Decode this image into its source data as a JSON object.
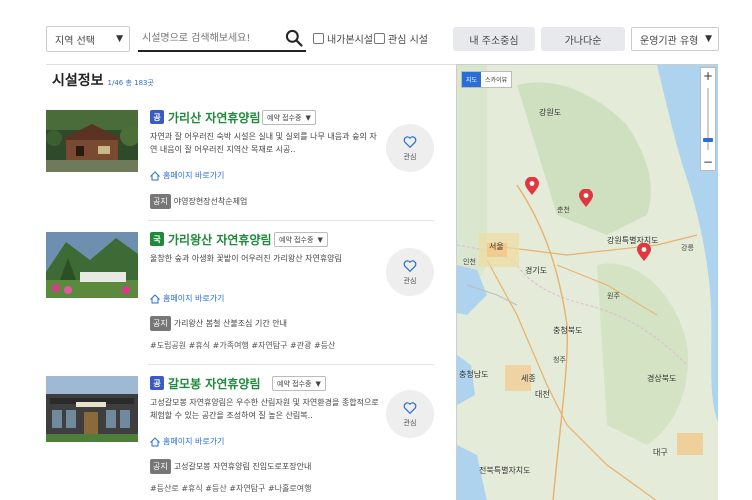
{
  "filters": {
    "region_select": "지역 선택",
    "search_placeholder": "시설명으로 검색해보세요!",
    "visited_label": "내가본시설",
    "interest_label": "관심 시설",
    "address_button": "내 주소중심",
    "alpha_button": "가나다순",
    "org_type_select": "운영기관 유형"
  },
  "list": {
    "title": "시설정보",
    "count": "1/46 총 183곳"
  },
  "facilities": [
    {
      "type_badge": "공",
      "type_color": "#3b5bc4",
      "name": "가리산 자연휴양림",
      "reservation": "예약 접수중",
      "description": "자연과 잘 어우러진 숙박 시설은 실내 및 실외를 나무 내음과 숲의 자연 내음이 잘 어우러진 지역산 목재로 시공..",
      "homepage": "홈페이지 바로가기",
      "notice_tag": "공지",
      "notice": "야영장현장선착순제업",
      "tags": "",
      "fav_label": "관심"
    },
    {
      "type_badge": "국",
      "type_color": "#1e8a3a",
      "name": "가리왕산 자연휴양림",
      "reservation": "예약 접수중",
      "description": "울창한 숲과 아생화 꽃밭이 어우러진 가리왕산 자연휴양림",
      "homepage": "홈페이지 바로가기",
      "notice_tag": "공지",
      "notice": "가리왕산 봄철 산불조심 기간 안내",
      "tags": "#도립공원 #휴식 #가족여행 #자연탐구 #관광 #등산",
      "fav_label": "관심"
    },
    {
      "type_badge": "공",
      "type_color": "#3b5bc4",
      "name": "갈모봉 자연휴양림",
      "reservation": "예약 접수중",
      "description": "고성갈모봉 자연휴양림은 우수한 산림자원 및 자연환경을 종합적으로 체험할 수 있는 공간을 조성하여 질 높은 산림복..",
      "homepage": "홈페이지 바로가기",
      "notice_tag": "공지",
      "notice": "고성갈모봉 자연휴양림 진입도로포장안내",
      "tags": "#등산로 #휴식 #등산 #자연탐구 #나홀로여행",
      "fav_label": "관심"
    }
  ],
  "map": {
    "type_map": "지도",
    "type_sky": "스카이뷰",
    "zoom_in": "+",
    "zoom_out": "−",
    "labels": {
      "gangwon": "강원도",
      "gangwon_special": "강원특별자치도",
      "seoul": "서울",
      "incheon": "인천",
      "gyeonggi": "경기도",
      "chungbuk": "충청북도",
      "chungnam": "충청남도",
      "gyeongbuk": "경상북도",
      "sejong": "세종",
      "daejeon": "대전",
      "daegu": "대구",
      "jeonbuk": "전북특별자치도",
      "chuncheon": "춘천",
      "gangneung": "강릉",
      "wonju": "원주",
      "cheongju": "청주"
    }
  }
}
